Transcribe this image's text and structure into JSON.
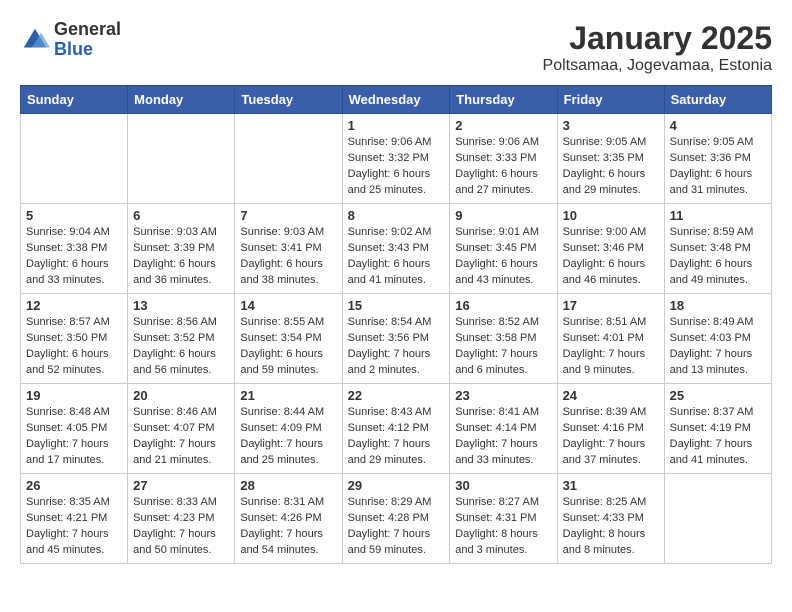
{
  "logo": {
    "general": "General",
    "blue": "Blue"
  },
  "title": "January 2025",
  "subtitle": "Poltsamaa, Jogevamaa, Estonia",
  "days": [
    "Sunday",
    "Monday",
    "Tuesday",
    "Wednesday",
    "Thursday",
    "Friday",
    "Saturday"
  ],
  "weeks": [
    [
      {
        "day": "",
        "content": ""
      },
      {
        "day": "",
        "content": ""
      },
      {
        "day": "",
        "content": ""
      },
      {
        "day": "1",
        "content": "Sunrise: 9:06 AM\nSunset: 3:32 PM\nDaylight: 6 hours\nand 25 minutes."
      },
      {
        "day": "2",
        "content": "Sunrise: 9:06 AM\nSunset: 3:33 PM\nDaylight: 6 hours\nand 27 minutes."
      },
      {
        "day": "3",
        "content": "Sunrise: 9:05 AM\nSunset: 3:35 PM\nDaylight: 6 hours\nand 29 minutes."
      },
      {
        "day": "4",
        "content": "Sunrise: 9:05 AM\nSunset: 3:36 PM\nDaylight: 6 hours\nand 31 minutes."
      }
    ],
    [
      {
        "day": "5",
        "content": "Sunrise: 9:04 AM\nSunset: 3:38 PM\nDaylight: 6 hours\nand 33 minutes."
      },
      {
        "day": "6",
        "content": "Sunrise: 9:03 AM\nSunset: 3:39 PM\nDaylight: 6 hours\nand 36 minutes."
      },
      {
        "day": "7",
        "content": "Sunrise: 9:03 AM\nSunset: 3:41 PM\nDaylight: 6 hours\nand 38 minutes."
      },
      {
        "day": "8",
        "content": "Sunrise: 9:02 AM\nSunset: 3:43 PM\nDaylight: 6 hours\nand 41 minutes."
      },
      {
        "day": "9",
        "content": "Sunrise: 9:01 AM\nSunset: 3:45 PM\nDaylight: 6 hours\nand 43 minutes."
      },
      {
        "day": "10",
        "content": "Sunrise: 9:00 AM\nSunset: 3:46 PM\nDaylight: 6 hours\nand 46 minutes."
      },
      {
        "day": "11",
        "content": "Sunrise: 8:59 AM\nSunset: 3:48 PM\nDaylight: 6 hours\nand 49 minutes."
      }
    ],
    [
      {
        "day": "12",
        "content": "Sunrise: 8:57 AM\nSunset: 3:50 PM\nDaylight: 6 hours\nand 52 minutes."
      },
      {
        "day": "13",
        "content": "Sunrise: 8:56 AM\nSunset: 3:52 PM\nDaylight: 6 hours\nand 56 minutes."
      },
      {
        "day": "14",
        "content": "Sunrise: 8:55 AM\nSunset: 3:54 PM\nDaylight: 6 hours\nand 59 minutes."
      },
      {
        "day": "15",
        "content": "Sunrise: 8:54 AM\nSunset: 3:56 PM\nDaylight: 7 hours\nand 2 minutes."
      },
      {
        "day": "16",
        "content": "Sunrise: 8:52 AM\nSunset: 3:58 PM\nDaylight: 7 hours\nand 6 minutes."
      },
      {
        "day": "17",
        "content": "Sunrise: 8:51 AM\nSunset: 4:01 PM\nDaylight: 7 hours\nand 9 minutes."
      },
      {
        "day": "18",
        "content": "Sunrise: 8:49 AM\nSunset: 4:03 PM\nDaylight: 7 hours\nand 13 minutes."
      }
    ],
    [
      {
        "day": "19",
        "content": "Sunrise: 8:48 AM\nSunset: 4:05 PM\nDaylight: 7 hours\nand 17 minutes."
      },
      {
        "day": "20",
        "content": "Sunrise: 8:46 AM\nSunset: 4:07 PM\nDaylight: 7 hours\nand 21 minutes."
      },
      {
        "day": "21",
        "content": "Sunrise: 8:44 AM\nSunset: 4:09 PM\nDaylight: 7 hours\nand 25 minutes."
      },
      {
        "day": "22",
        "content": "Sunrise: 8:43 AM\nSunset: 4:12 PM\nDaylight: 7 hours\nand 29 minutes."
      },
      {
        "day": "23",
        "content": "Sunrise: 8:41 AM\nSunset: 4:14 PM\nDaylight: 7 hours\nand 33 minutes."
      },
      {
        "day": "24",
        "content": "Sunrise: 8:39 AM\nSunset: 4:16 PM\nDaylight: 7 hours\nand 37 minutes."
      },
      {
        "day": "25",
        "content": "Sunrise: 8:37 AM\nSunset: 4:19 PM\nDaylight: 7 hours\nand 41 minutes."
      }
    ],
    [
      {
        "day": "26",
        "content": "Sunrise: 8:35 AM\nSunset: 4:21 PM\nDaylight: 7 hours\nand 45 minutes."
      },
      {
        "day": "27",
        "content": "Sunrise: 8:33 AM\nSunset: 4:23 PM\nDaylight: 7 hours\nand 50 minutes."
      },
      {
        "day": "28",
        "content": "Sunrise: 8:31 AM\nSunset: 4:26 PM\nDaylight: 7 hours\nand 54 minutes."
      },
      {
        "day": "29",
        "content": "Sunrise: 8:29 AM\nSunset: 4:28 PM\nDaylight: 7 hours\nand 59 minutes."
      },
      {
        "day": "30",
        "content": "Sunrise: 8:27 AM\nSunset: 4:31 PM\nDaylight: 8 hours\nand 3 minutes."
      },
      {
        "day": "31",
        "content": "Sunrise: 8:25 AM\nSunset: 4:33 PM\nDaylight: 8 hours\nand 8 minutes."
      },
      {
        "day": "",
        "content": ""
      }
    ]
  ]
}
